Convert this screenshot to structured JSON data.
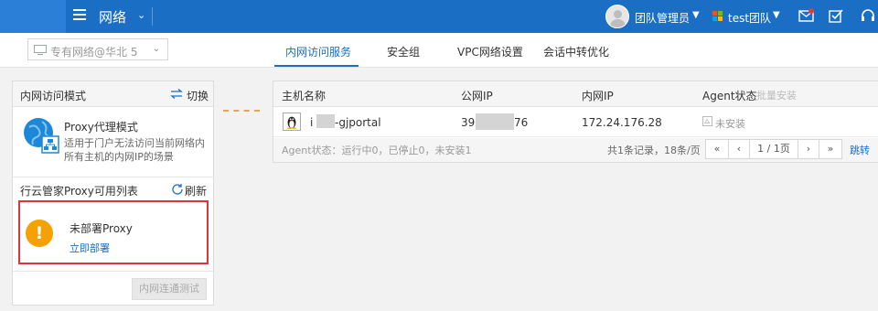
{
  "topbar": {
    "title": "网络",
    "user_name": "团队管理员",
    "team_name": "test团队",
    "colors": {
      "bar": "#1a6fc4",
      "accent": "#1a6fc4"
    }
  },
  "subbar": {
    "network_select": {
      "value": "专有网络@华北 5"
    },
    "tabs": [
      {
        "label": "内网访问服务",
        "active": true
      },
      {
        "label": "安全组",
        "active": false
      },
      {
        "label": "VPC网络设置",
        "active": false
      },
      {
        "label": "会话中转优化",
        "active": false
      }
    ]
  },
  "left_panel": {
    "header_title": "内网访问模式",
    "switch_label": "切换",
    "proxy_mode_title": "Proxy代理模式",
    "proxy_mode_desc": "适用于门户无法访问当前网络内所有主机的内网IP的场景",
    "list_title": "行云管家Proxy可用列表",
    "refresh_label": "刷新",
    "warning": {
      "title": "未部署Proxy",
      "link": "立即部署"
    },
    "test_button": "内网连通测试"
  },
  "table": {
    "headers": {
      "host": "主机名称",
      "public_ip": "公网IP",
      "private_ip": "内网IP",
      "agent": "Agent状态",
      "batch": "批量安装"
    },
    "rows": [
      {
        "host_prefix": "i",
        "host_suffix": "-gjportal",
        "public_ip_prefix": "39",
        "public_ip_suffix": "76",
        "private_ip": "172.24.176.28",
        "agent_status": "未安装"
      }
    ],
    "agent_summary": "Agent状态：运行中0，已停止0，未安装1",
    "total": "共1条记录，18条/页",
    "pager": {
      "first": "«",
      "prev": "‹",
      "page": "1 / 1页",
      "next": "›",
      "last": "»"
    },
    "jump": "跳转"
  }
}
